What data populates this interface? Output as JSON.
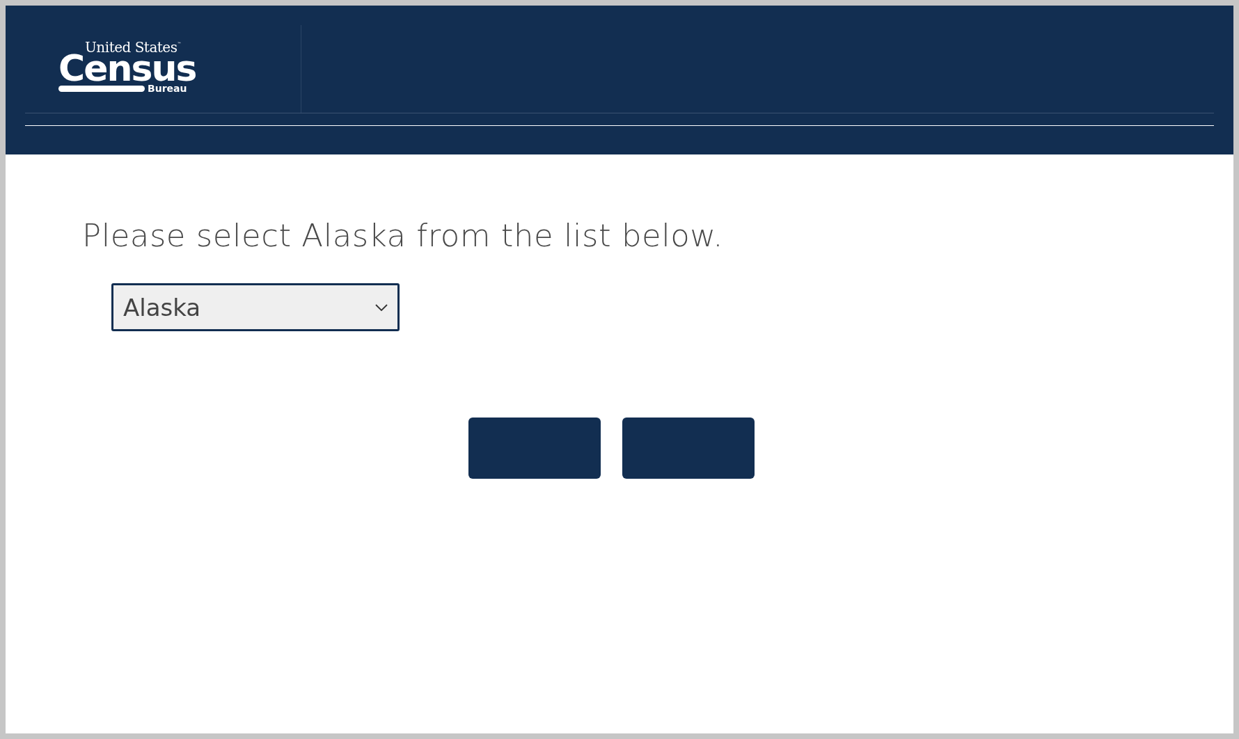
{
  "header": {
    "logo": {
      "line_1": "United States",
      "trademark": "™",
      "line_2": "Census",
      "line_3": "Bureau"
    }
  },
  "prompt": "Please select Alaska from the list below.",
  "state_select": {
    "value": "Alaska"
  }
}
